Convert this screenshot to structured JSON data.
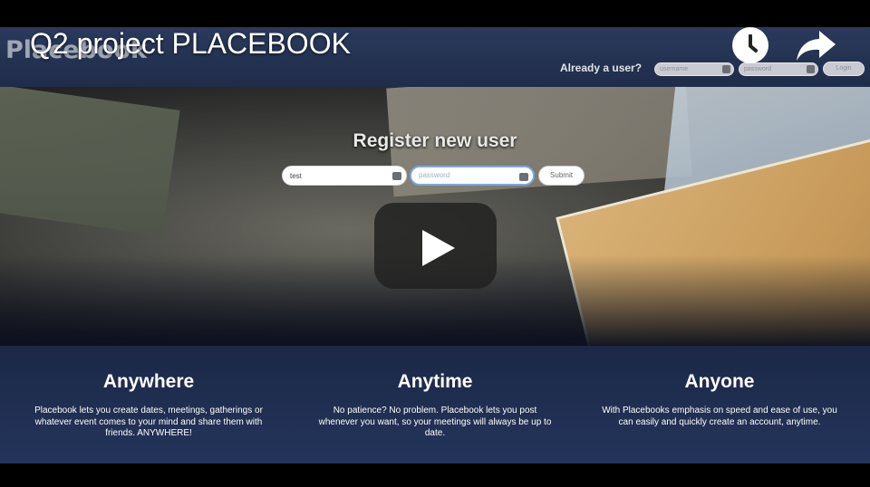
{
  "video": {
    "title": "Q2 project PLACEBOOK"
  },
  "site": {
    "logo": "Placebook",
    "header": {
      "already_label": "Already a user?",
      "username_placeholder": "username",
      "password_placeholder": "password",
      "login_label": "Login"
    },
    "register": {
      "title": "Register new user",
      "username_value": "test",
      "password_placeholder": "password",
      "submit_label": "Submit"
    },
    "features": [
      {
        "title": "Anywhere",
        "text": "Placebook lets you create dates, meetings, gatherings or whatever event comes to your mind and share them with friends. ANYWHERE!"
      },
      {
        "title": "Anytime",
        "text": "No patience? No problem. Placebook lets you post whenever you want, so your meetings will always be up to date."
      },
      {
        "title": "Anyone",
        "text": "With Placebooks emphasis on speed and ease of use, you can easily and quickly create an account, anytime."
      }
    ]
  },
  "icons": {
    "watch_later": "clock-icon",
    "share": "share-arrow-icon",
    "play": "play-icon"
  },
  "colors": {
    "header_bg": "#2b3a5c",
    "features_bg": "#1b2847",
    "play_button": "#212121"
  }
}
